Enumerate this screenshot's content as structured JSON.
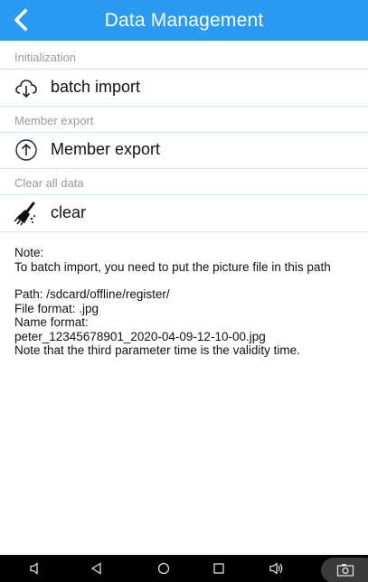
{
  "header": {
    "title": "Data Management",
    "back_icon": "chevron-left-icon",
    "color": "#2b9bf2"
  },
  "sections": {
    "initialization": {
      "header": "Initialization",
      "row_label": "batch import",
      "row_icon": "cloud-download-icon"
    },
    "member_export": {
      "header": "Member export",
      "row_label": "Member export",
      "row_icon": "upload-arrow-icon"
    },
    "clear_all": {
      "header": "Clear all data",
      "row_label": "clear",
      "row_icon": "broom-icon"
    }
  },
  "note": {
    "title": "Note:",
    "intro": "To batch import, you need to put the picture file in this path",
    "path": "Path: /sdcard/offline/register/",
    "file_format": "File format: .jpg",
    "name_format_label": "Name format:",
    "name_format_example": "peter_12345678901_2020-04-09-12-10-00.jpg",
    "validity_note": "Note that the third parameter time is the validity time."
  },
  "navbar": {
    "icons": [
      "volume-down-icon",
      "back-triangle-icon",
      "home-circle-icon",
      "recents-square-icon",
      "volume-up-icon",
      "screenshot-icon"
    ]
  }
}
